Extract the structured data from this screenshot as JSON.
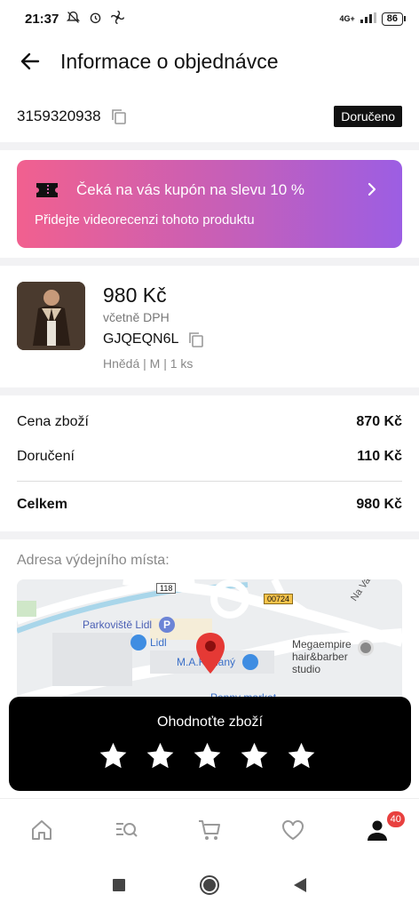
{
  "status_bar": {
    "time": "21:37",
    "network": "4G+",
    "battery": "86"
  },
  "header": {
    "title": "Informace o objednávce"
  },
  "order": {
    "number": "3159320938",
    "status": "Doručeno"
  },
  "coupon": {
    "title": "Čeká na vás kupón na slevu 10 %",
    "subtitle": "Přidejte videorecenzi tohoto produktu"
  },
  "product": {
    "price": "980 Kč",
    "vat_note": "včetně DPH",
    "sku": "GJQEQN6L",
    "variant": "Hnědá | M | 1 ks"
  },
  "summary": {
    "goods_label": "Cena zboží",
    "goods_value": "870 Kč",
    "delivery_label": "Doručení",
    "delivery_value": "110 Kč",
    "total_label": "Celkem",
    "total_value": "980 Kč"
  },
  "address": {
    "label": "Adresa výdejního místa:",
    "map": {
      "road_118": "118",
      "road_00724": "00724",
      "street": "Na Vavřinci",
      "parking": "Parkoviště Lidl",
      "store": "Lidl",
      "pickup": "M.A.K.Slaný",
      "barber": "Megaempire hair&barber studio",
      "partial": "Penny market"
    }
  },
  "rating": {
    "title": "Ohodnoťte zboží",
    "stars": 5
  },
  "bottom_nav": {
    "profile_badge": "40"
  },
  "colors": {
    "accent_red": "#e8403f",
    "coupon_start": "#f1608f",
    "coupon_end": "#9c5ee3"
  }
}
